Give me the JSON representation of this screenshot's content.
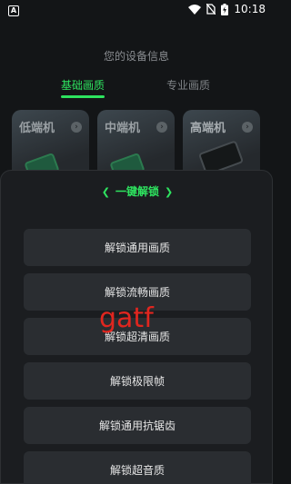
{
  "status_bar": {
    "left_icon": "A",
    "time": "10:18",
    "icons": [
      "wifi-icon",
      "no-sim-icon",
      "battery-charging-icon"
    ]
  },
  "header": {
    "title": "您的设备信息"
  },
  "tabs": [
    {
      "label": "基础画质",
      "active": true
    },
    {
      "label": "专业画质",
      "active": false
    }
  ],
  "cards": [
    {
      "label": "低端机"
    },
    {
      "label": "中端机"
    },
    {
      "label": "高端机"
    }
  ],
  "sheet": {
    "title": "一键解锁",
    "buttons": [
      {
        "label": "解锁通用画质"
      },
      {
        "label": "解锁流畅画质"
      },
      {
        "label": "解锁超清画质"
      },
      {
        "label": "解锁极限帧"
      },
      {
        "label": "解锁通用抗锯齿"
      },
      {
        "label": "解锁超音质"
      }
    ]
  },
  "watermark": "gatf",
  "colors": {
    "accent": "#2ee35f",
    "background": "#131517",
    "sheet": "#1b1d20",
    "button": "#2a2d31",
    "watermark": "#e0261f"
  }
}
